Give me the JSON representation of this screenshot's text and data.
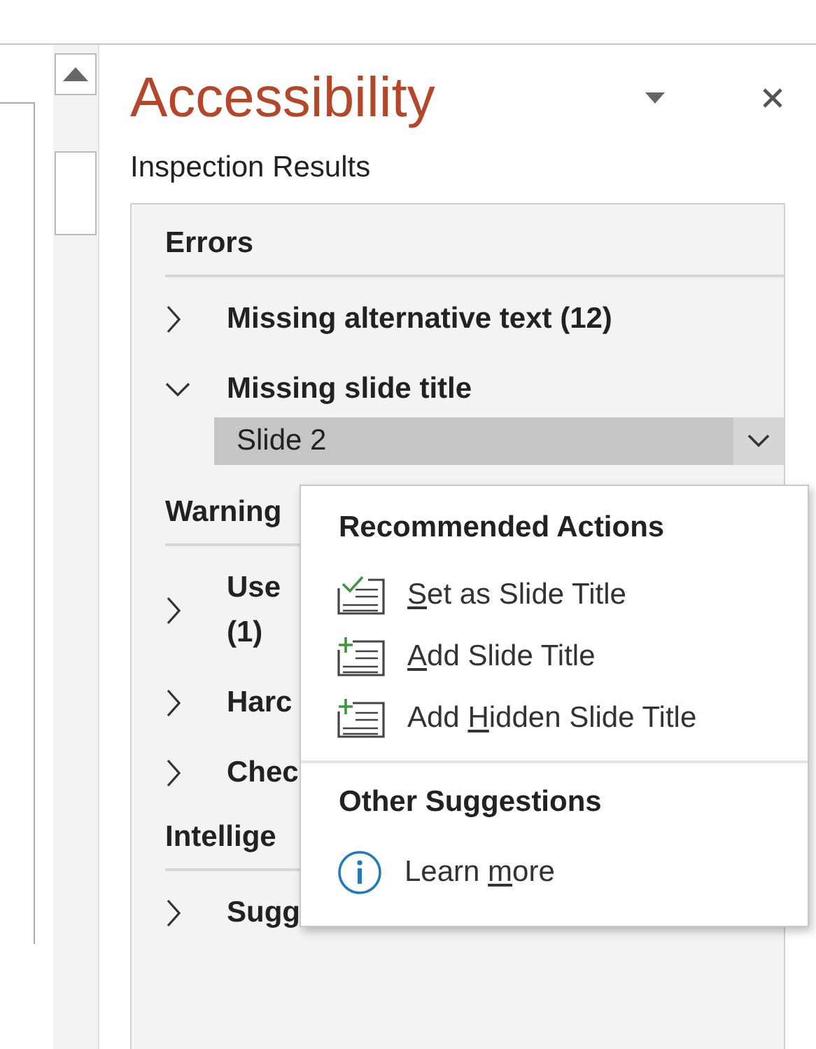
{
  "pane": {
    "title": "Accessibility",
    "subtitle": "Inspection Results"
  },
  "sections": [
    {
      "heading": "Errors",
      "items": [
        {
          "label": "Missing alternative text (12)",
          "expanded": false
        },
        {
          "label": "Missing slide title",
          "expanded": true,
          "children": [
            {
              "label": "Slide 2",
              "selected": true
            }
          ]
        }
      ]
    },
    {
      "heading": "Warning",
      "items": [
        {
          "label": "Use\n(1)",
          "expanded": false
        },
        {
          "label": "Harc",
          "expanded": false
        },
        {
          "label": "Chec",
          "expanded": false
        }
      ]
    },
    {
      "heading": "Intellige",
      "items": [
        {
          "label": "Sugg",
          "expanded": false
        }
      ]
    }
  ],
  "popup": {
    "groups": [
      {
        "heading": "Recommended Actions",
        "actions": [
          {
            "kind": "check",
            "key": "S",
            "post": "et as Slide Title"
          },
          {
            "kind": "add",
            "key": "A",
            "post": "dd Slide Title"
          },
          {
            "kind": "add",
            "pre": "Add ",
            "key": "H",
            "post": "idden Slide Title"
          }
        ]
      },
      {
        "heading": "Other Suggestions",
        "actions": [
          {
            "kind": "info",
            "pre": "Learn ",
            "key": "m",
            "post": "ore"
          }
        ]
      }
    ]
  }
}
